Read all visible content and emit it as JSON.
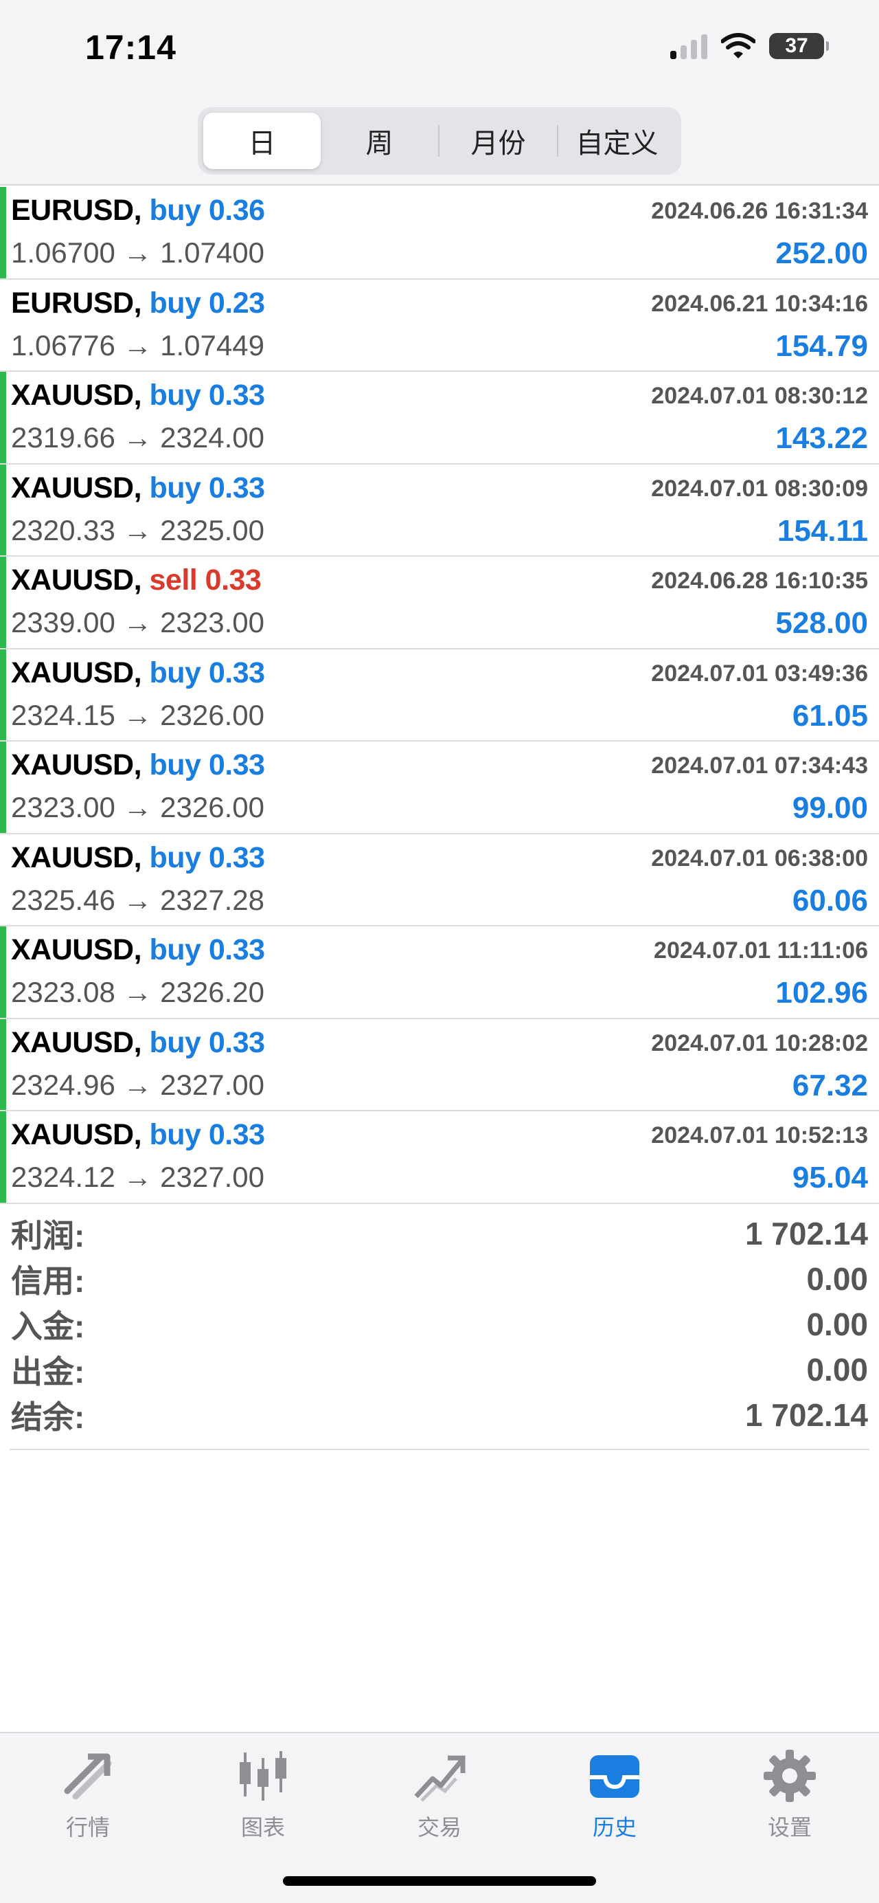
{
  "status_bar": {
    "time": "17:14",
    "battery": "37"
  },
  "period_tabs": [
    {
      "label": "日",
      "active": true
    },
    {
      "label": "周",
      "active": false
    },
    {
      "label": "月份",
      "active": false
    },
    {
      "label": "自定义",
      "active": false
    }
  ],
  "deals": [
    {
      "symbol": "EURUSD,",
      "type": "buy 0.36",
      "side": "buy",
      "datetime": "2024.06.26 16:31:34",
      "prices": "1.06700 → 1.07400",
      "profit": "252.00",
      "marker": true
    },
    {
      "symbol": "EURUSD,",
      "type": "buy 0.23",
      "side": "buy",
      "datetime": "2024.06.21 10:34:16",
      "prices": "1.06776 → 1.07449",
      "profit": "154.79",
      "marker": false
    },
    {
      "symbol": "XAUUSD,",
      "type": "buy 0.33",
      "side": "buy",
      "datetime": "2024.07.01 08:30:12",
      "prices": "2319.66 → 2324.00",
      "profit": "143.22",
      "marker": true
    },
    {
      "symbol": "XAUUSD,",
      "type": "buy 0.33",
      "side": "buy",
      "datetime": "2024.07.01 08:30:09",
      "prices": "2320.33 → 2325.00",
      "profit": "154.11",
      "marker": true
    },
    {
      "symbol": "XAUUSD,",
      "type": "sell 0.33",
      "side": "sell",
      "datetime": "2024.06.28 16:10:35",
      "prices": "2339.00 → 2323.00",
      "profit": "528.00",
      "marker": true
    },
    {
      "symbol": "XAUUSD,",
      "type": "buy 0.33",
      "side": "buy",
      "datetime": "2024.07.01 03:49:36",
      "prices": "2324.15 → 2326.00",
      "profit": "61.05",
      "marker": true
    },
    {
      "symbol": "XAUUSD,",
      "type": "buy 0.33",
      "side": "buy",
      "datetime": "2024.07.01 07:34:43",
      "prices": "2323.00 → 2326.00",
      "profit": "99.00",
      "marker": true
    },
    {
      "symbol": "XAUUSD,",
      "type": "buy 0.33",
      "side": "buy",
      "datetime": "2024.07.01 06:38:00",
      "prices": "2325.46 → 2327.28",
      "profit": "60.06",
      "marker": false
    },
    {
      "symbol": "XAUUSD,",
      "type": "buy 0.33",
      "side": "buy",
      "datetime": "2024.07.01 11:11:06",
      "prices": "2323.08 → 2326.20",
      "profit": "102.96",
      "marker": true
    },
    {
      "symbol": "XAUUSD,",
      "type": "buy 0.33",
      "side": "buy",
      "datetime": "2024.07.01 10:28:02",
      "prices": "2324.96 → 2327.00",
      "profit": "67.32",
      "marker": true
    },
    {
      "symbol": "XAUUSD,",
      "type": "buy 0.33",
      "side": "buy",
      "datetime": "2024.07.01 10:52:13",
      "prices": "2324.12 → 2327.00",
      "profit": "95.04",
      "marker": true
    }
  ],
  "summary": [
    {
      "label": "利润:",
      "value": "1 702.14"
    },
    {
      "label": "信用:",
      "value": "0.00"
    },
    {
      "label": "入金:",
      "value": "0.00"
    },
    {
      "label": "出金:",
      "value": "0.00"
    },
    {
      "label": "结余:",
      "value": "1 702.14"
    }
  ],
  "tabbar": [
    {
      "label": "行情",
      "icon": "quotes-arrows-icon",
      "active": false
    },
    {
      "label": "图表",
      "icon": "candlestick-chart-icon",
      "active": false
    },
    {
      "label": "交易",
      "icon": "trade-trend-icon",
      "active": false
    },
    {
      "label": "历史",
      "icon": "history-tray-icon",
      "active": true
    },
    {
      "label": "设置",
      "icon": "gear-icon",
      "active": false
    }
  ],
  "colors": {
    "buy": "#1a7ee0",
    "sell": "#d93a2b",
    "marker": "#2fb84a",
    "inactive": "#8e8e93"
  }
}
